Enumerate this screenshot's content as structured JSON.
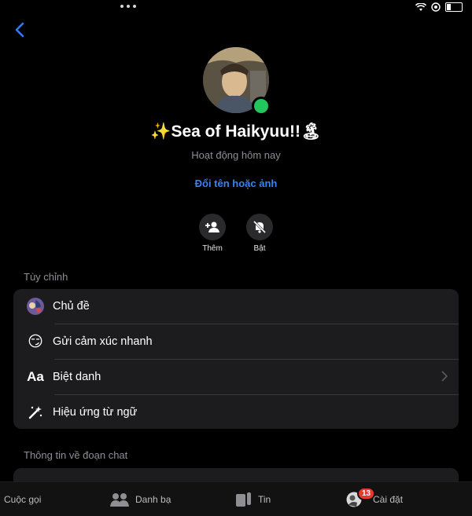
{
  "group": {
    "name": "Sea of Haikyuu!!",
    "name_prefix_emoji": "✨",
    "name_suffix_emoji": "🏝",
    "status": "Hoạt động hôm nay",
    "rename_link": "Đổi tên hoặc ảnh"
  },
  "actions": [
    {
      "label": "Thêm",
      "icon": "add-person-icon"
    },
    {
      "label": "Bật",
      "icon": "bell-muted-icon"
    }
  ],
  "customize": {
    "heading": "Tùy chỉnh",
    "items": [
      {
        "label": "Chủ đề",
        "icon": "theme-icon"
      },
      {
        "label": "Gửi cảm xúc nhanh",
        "icon": "emoji-icon",
        "emoji": "😏"
      },
      {
        "label": "Biệt danh",
        "icon": "nickname-icon",
        "glyph": "Aa"
      },
      {
        "label": "Hiệu ứng từ ngữ",
        "icon": "magic-wand-icon"
      }
    ]
  },
  "chat_info": {
    "heading": "Thông tin về đoạn chat"
  },
  "tabbar": {
    "items": [
      {
        "label": "Cuộc gọi",
        "icon": "call-icon"
      },
      {
        "label": "Danh bạ",
        "icon": "contacts-icon"
      },
      {
        "label": "Tin",
        "icon": "stories-icon"
      },
      {
        "label": "Cài đặt",
        "icon": "settings-avatar-icon",
        "badge": "13"
      }
    ]
  },
  "colors": {
    "accent": "#3b82f6",
    "online": "#22c55e",
    "badge": "#e5392f"
  }
}
